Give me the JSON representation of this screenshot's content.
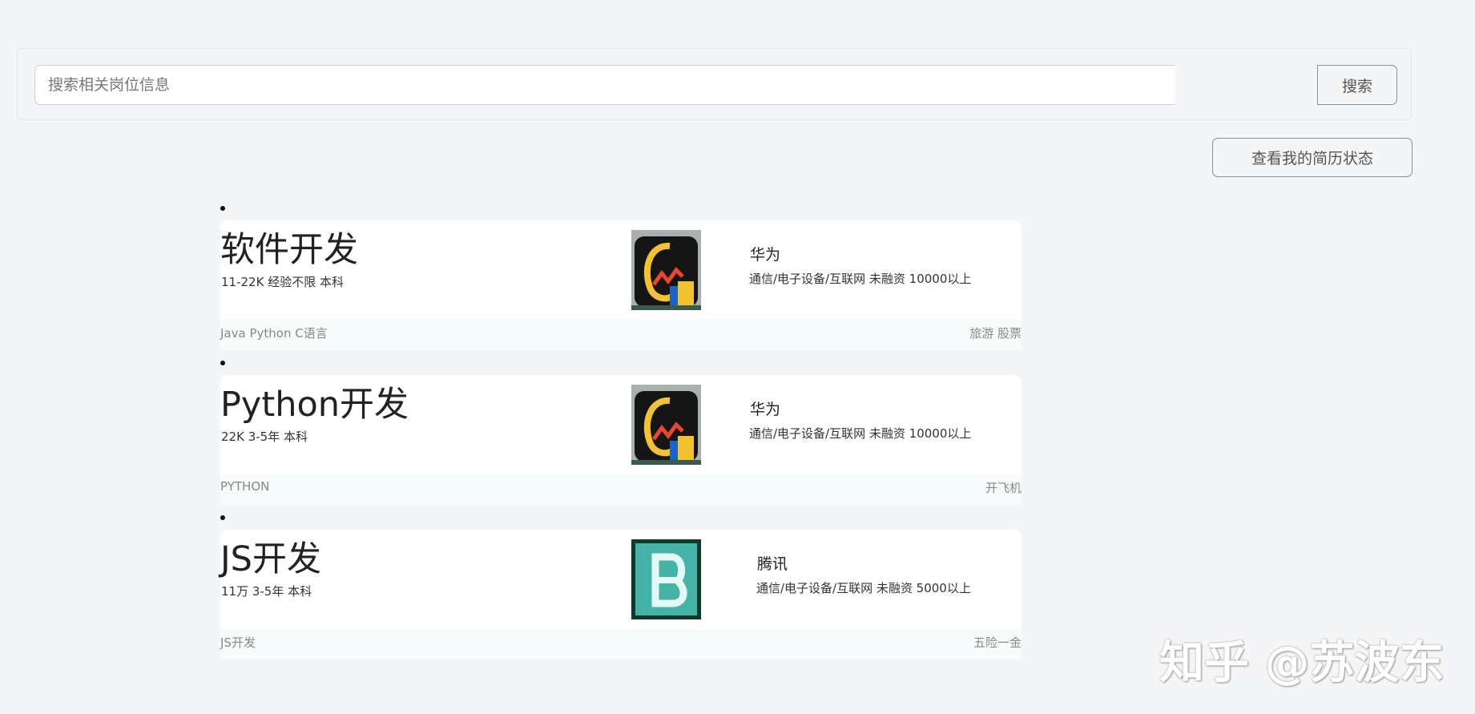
{
  "search": {
    "placeholder": "搜索相关岗位信息",
    "button_label": "搜索"
  },
  "resume_button_label": "查看我的简历状态",
  "jobs": [
    {
      "title": "软件开发",
      "meta": "11-22K  经验不限  本科",
      "company": "华为",
      "company_info": "通信/电子设备/互联网  未融资  10000以上",
      "skills": "Java Python C语言",
      "welfare": "旅游 股票",
      "logo_icon": "company-logo-icon"
    },
    {
      "title": "Python开发",
      "meta": "22K  3-5年  本科",
      "company": "华为",
      "company_info": "通信/电子设备/互联网  未融资  10000以上",
      "skills": "PYTHON",
      "welfare": "开飞机",
      "logo_icon": "company-logo-icon"
    },
    {
      "title": "JS开发",
      "meta": "11万  3-5年  本科",
      "company": "腾讯",
      "company_info": "通信/电子设备/互联网  未融资  5000以上",
      "skills": "JS开发",
      "welfare": "五险一金",
      "logo_icon": "letter-b-logo-icon"
    }
  ],
  "watermark": "知乎 @苏波东"
}
